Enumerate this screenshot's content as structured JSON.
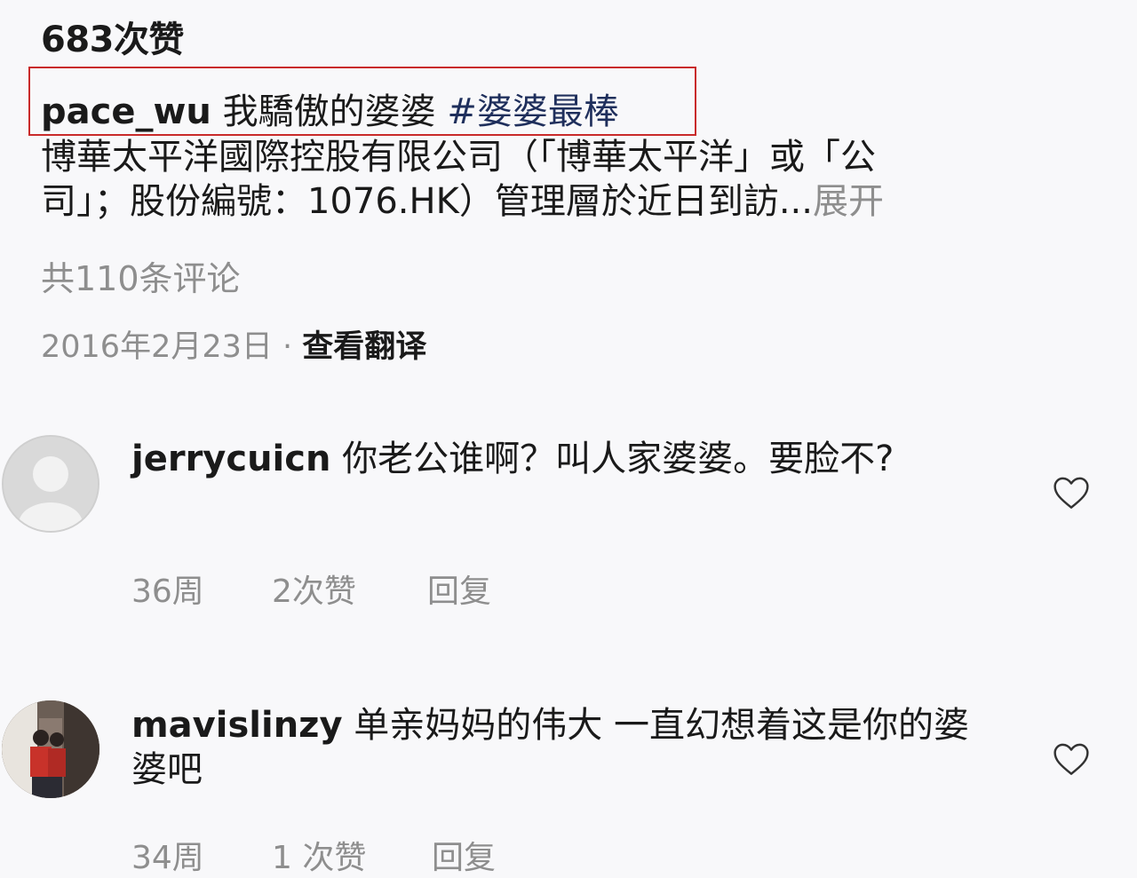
{
  "post": {
    "likes": "683次赞",
    "caption_user": "pace_wu",
    "caption_text": "我驕傲的婆婆",
    "caption_hashtag": "#婆婆最棒",
    "body_line1": "博華太平洋國際控股有限公司（「博華太平洋」或「公",
    "body_line2": "司」；股份編號：1076.HK）管理層於近日到訪...",
    "expand_label": "展开",
    "comment_count": "共110条评论",
    "date": "2016年2月23日",
    "separator": " · ",
    "translate_label": "查看翻译"
  },
  "comments": [
    {
      "user": "jerrycuicn",
      "text": "你老公谁啊？叫人家婆婆。要脸不?",
      "time": "36周",
      "likes": "2次赞",
      "reply": "回复",
      "avatar": "default-avatar",
      "like_icon": "heart-outline-icon"
    },
    {
      "user": "mavislinzy",
      "text": "单亲妈妈的伟大 一直幻想着这是你的婆婆吧",
      "time": "34周",
      "likes": "1 次赞",
      "reply": "回复",
      "avatar": "photo-avatar",
      "like_icon": "heart-outline-icon"
    }
  ],
  "colors": {
    "highlight_border": "#c92a2a",
    "secondary_text": "#8e8e8e",
    "background": "#f8f8fa"
  }
}
